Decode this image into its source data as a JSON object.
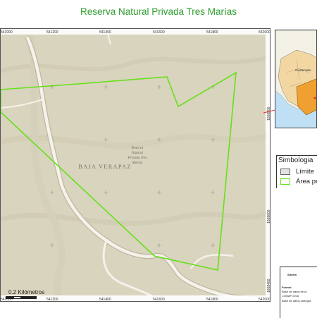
{
  "title": "Reserva Natural Privada Tres Marías",
  "map": {
    "region_label": "BAJA VERAPAZ",
    "reserve_label": "Reserva Natural Privada Tres Marías",
    "reserve_label_lines": [
      "Reserva",
      "Natural",
      "Privada Tres",
      "Marías"
    ],
    "x_ticks": [
      "541000",
      "541200",
      "541400",
      "541600",
      "541800",
      "542000"
    ],
    "y_ticks": [
      "1668800",
      "1668600",
      "1668400"
    ],
    "colors": {
      "boundary": "#66e01a",
      "terrain": "#d8d3bd",
      "road": "#f5f3ec",
      "ocean": "#bfe0f4",
      "highlight": "#f0a030"
    }
  },
  "inset": {
    "caption": "Guatemala"
  },
  "legend": {
    "title": "Simbologia",
    "items": [
      {
        "label": "Límite",
        "swatch": "#e2e2e2",
        "border": "#666"
      },
      {
        "label": "Área pr",
        "swatch": "#ffffff",
        "border": "#66e01a"
      }
    ]
  },
  "info": {
    "lines": [
      "Sistem",
      "Fuente:",
      "Base de datos de la",
      "CONAP 2016",
      "Base de datos cartogra"
    ]
  },
  "scale": {
    "label": "0.2 Kilómetros"
  }
}
